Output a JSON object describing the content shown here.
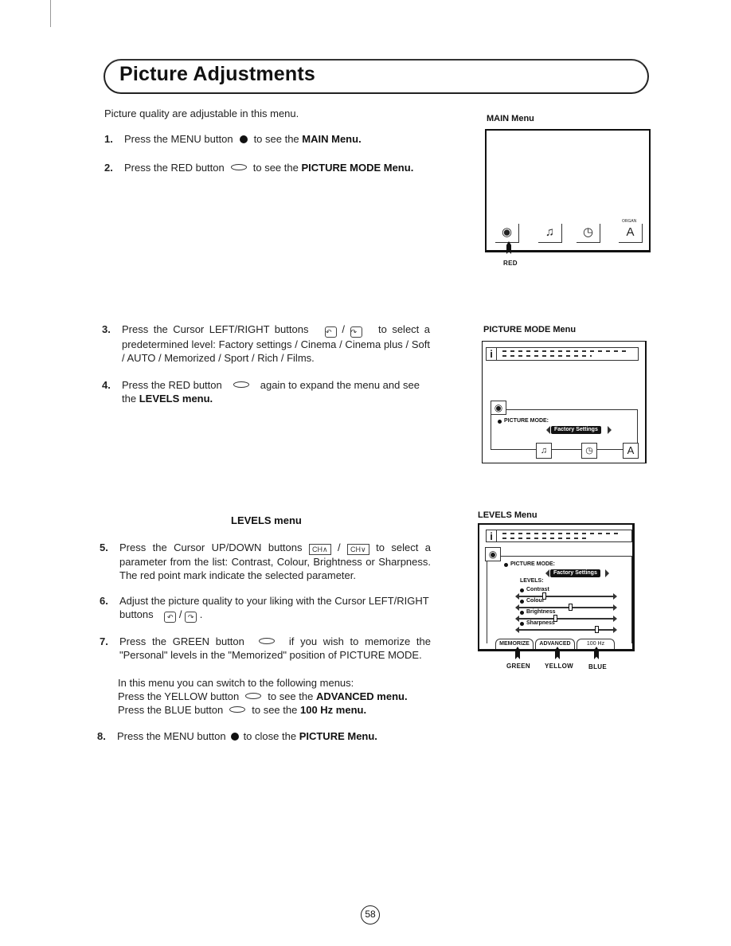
{
  "page": {
    "title": "Picture Adjustments",
    "page_number": "58"
  },
  "intro": "Picture quality are adjustable in this menu.",
  "steps": [
    {
      "num": "1.",
      "pre": "Press the MENU button",
      "icon": "menu-dot-icon",
      "post": "to see the",
      "bold": "MAIN Menu."
    },
    {
      "num": "2.",
      "pre": "Press the RED button",
      "icon": "red-oval-icon",
      "post": "to see the",
      "bold": "PICTURE MODE Menu."
    },
    {
      "num": "3.",
      "pre": "Press the Cursor LEFT/RIGHT buttons",
      "icon_left": "cursor-left-icon",
      "sep": "/",
      "icon_right": "cursor-right-icon",
      "post": "to select a predetermined level: Factory settings / Cinema / Cinema plus / Soft / AUTO / Memorized / Sport / Rich / Films."
    },
    {
      "num": "4.",
      "pre": "Press the RED button",
      "icon": "red-oval-icon",
      "post": "again to expand the menu and see the",
      "bold": "LEVELS menu."
    },
    {
      "num": "5.",
      "pre": "Press the Cursor UP/DOWN buttons",
      "icon_left_text": "CH∧",
      "sep": "/",
      "icon_right_text": "CH∨",
      "post": "to select a parameter from the list: Contrast, Colour, Brightness or Sharpness. The red point mark indicate the selected parameter."
    },
    {
      "num": "6.",
      "pre": "Adjust the picture quality to your liking with the Cursor LEFT/RIGHT buttons",
      "sep": "/",
      "post": "."
    },
    {
      "num": "7.",
      "pre": "Press the GREEN button",
      "post": "if you wish to memorize the \"Personal\" levels in the \"Memorized\" position of PICTURE MODE."
    },
    {
      "num": "8.",
      "pre": "Press the MENU button",
      "post": "to close the",
      "bold": "PICTURE Menu."
    }
  ],
  "switch_note": {
    "intro": "In this menu you can switch to the following menus:",
    "yellow_pre": "Press the YELLOW button",
    "yellow_post": "to see the",
    "yellow_bold": "ADVANCED menu.",
    "blue_pre": "Press the BLUE button",
    "blue_post": "to see the",
    "blue_bold": "100 Hz menu."
  },
  "levels_heading": "LEVELS menu",
  "figures": {
    "main_menu": {
      "label": "MAIN Menu",
      "icons": [
        "picture-eye-icon",
        "sound-note-icon",
        "features-clock-icon",
        "install-antenna-icon"
      ],
      "install_icon_text": "ORGAN",
      "pointer_label": "RED"
    },
    "picture_mode": {
      "label": "PICTURE MODE Menu",
      "info_icon": "i",
      "field_label": "PICTURE MODE:",
      "selected_value": "Factory Settings"
    },
    "levels": {
      "label": "LEVELS Menu",
      "info_icon": "i",
      "field_label": "PICTURE MODE:",
      "selected_value": "Factory Settings",
      "levels_label": "LEVELS:",
      "sliders": [
        {
          "name": "Contrast",
          "value_pct": 25
        },
        {
          "name": "Colour",
          "value_pct": 55
        },
        {
          "name": "Brightness",
          "value_pct": 38
        },
        {
          "name": "Sharpness",
          "value_pct": 85
        }
      ],
      "tabs": [
        "MEMORIZE",
        "ADVANCED",
        "100 Hz"
      ],
      "button_labels": [
        "GREEN",
        "YELLOW",
        "BLUE"
      ]
    }
  }
}
